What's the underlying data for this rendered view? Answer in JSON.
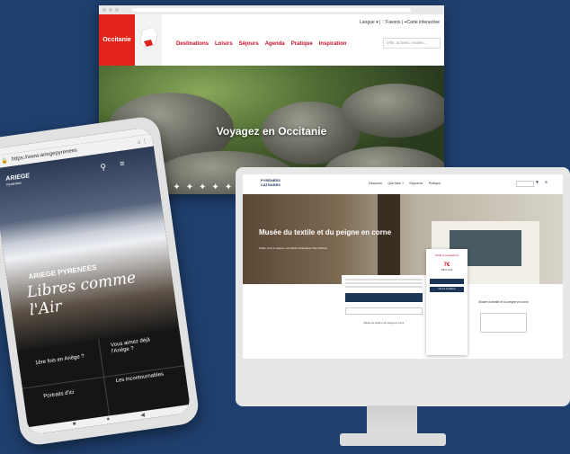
{
  "colors": {
    "background": "#1f3f6e",
    "occitanie_red": "#e2231a"
  },
  "occitanie": {
    "logo_text": "Occitanie",
    "top_links": [
      "Langue",
      "Favoris",
      "Carte interactive"
    ],
    "nav": [
      "Destinations",
      "Loisirs",
      "Séjours",
      "Agenda",
      "Pratique",
      "Inspiration"
    ],
    "search_placeholder": "Ville, activité, musée...",
    "hero_title": "Voyagez en Occitanie"
  },
  "museum_site": {
    "logo_line1": "PYRÉNÉES",
    "logo_line2": "CATHARES",
    "nav": [
      "Découvrir",
      "Que faire ?",
      "Séjourner",
      "Pratique"
    ],
    "hero_title": "Musée du textile et du peigne en corne",
    "hero_subtitle": "Textile, corne et peignes, une histoire d'artisanat en Pays d'Olmes",
    "price_card": {
      "heading": "Tarifs et prestations",
      "price": "7€",
      "unit": "Plein tarif",
      "button": "Voir les conditions"
    },
    "content_heading": "Musée du textile et du peigne en corne",
    "right_text": "Musée du textile et du peigne en corne"
  },
  "phone": {
    "url": "https://www.ariegepyrenees",
    "brand": "ARIEGE",
    "brand_sub": "Pyrénées",
    "tagline_top": "ARIEGE PYRENEES",
    "tagline_main": "Libres comme l'Air",
    "tiles": [
      "1ère fois en Ariège ?",
      "Vous aimez déjà l'Ariège ?",
      "Portraits d'ici",
      "Les incontournables"
    ]
  }
}
